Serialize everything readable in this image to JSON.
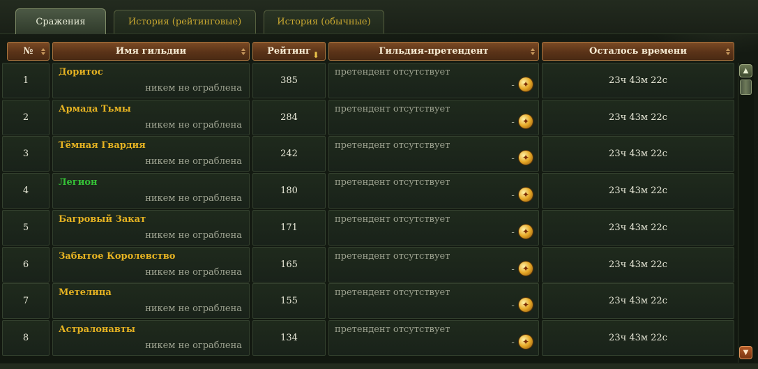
{
  "tabs": [
    {
      "label": "Сражения",
      "active": true
    },
    {
      "label": "История (рейтинговые)",
      "active": false
    },
    {
      "label": "История (обычные)",
      "active": false
    }
  ],
  "columns": {
    "num": "№",
    "guild_name": "Имя гильдии",
    "rating": "Рейтинг",
    "pretender": "Гильдия-претендент",
    "time_left": "Осталось времени"
  },
  "sort_indicator_icon": "sort-desc-arrow-icon",
  "coin_icon": "gold-coin-icon",
  "colors": {
    "guild_name": "#e6b322",
    "guild_name_highlight": "#35c237",
    "header_bg": "#5a3318",
    "row_bg": "#1f2a1c"
  },
  "rows": [
    {
      "num": "1",
      "name": "Доритос",
      "highlight": false,
      "robbed": "никем не ограблена",
      "rating": "385",
      "pretender": "претендент отсутствует",
      "dash": "-",
      "time": "23ч 43м 22с"
    },
    {
      "num": "2",
      "name": "Армада Тьмы",
      "highlight": false,
      "robbed": "никем не ограблена",
      "rating": "284",
      "pretender": "претендент отсутствует",
      "dash": "-",
      "time": "23ч 43м 22с"
    },
    {
      "num": "3",
      "name": "Тёмная Гвардия",
      "highlight": false,
      "robbed": "никем не ограблена",
      "rating": "242",
      "pretender": "претендент отсутствует",
      "dash": "-",
      "time": "23ч 43м 22с"
    },
    {
      "num": "4",
      "name": "Легион",
      "highlight": true,
      "robbed": "никем не ограблена",
      "rating": "180",
      "pretender": "претендент отсутствует",
      "dash": "-",
      "time": "23ч 43м 22с"
    },
    {
      "num": "5",
      "name": "Багровый Закат",
      "highlight": false,
      "robbed": "никем не ограблена",
      "rating": "171",
      "pretender": "претендент отсутствует",
      "dash": "-",
      "time": "23ч 43м 22с"
    },
    {
      "num": "6",
      "name": "Забытое Королевство",
      "highlight": false,
      "robbed": "никем не ограблена",
      "rating": "165",
      "pretender": "претендент отсутствует",
      "dash": "-",
      "time": "23ч 43м 22с"
    },
    {
      "num": "7",
      "name": "Метелица",
      "highlight": false,
      "robbed": "никем не ограблена",
      "rating": "155",
      "pretender": "претендент отсутствует",
      "dash": "-",
      "time": "23ч 43м 22с"
    },
    {
      "num": "8",
      "name": "Астралонавты",
      "highlight": false,
      "robbed": "никем не ограблена",
      "rating": "134",
      "pretender": "претендент отсутствует",
      "dash": "-",
      "time": "23ч 43м 22с"
    }
  ]
}
